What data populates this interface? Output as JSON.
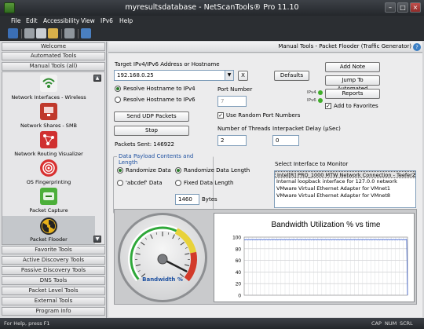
{
  "window": {
    "title": "myresultsdatabase - NetScanTools® Pro 11.10"
  },
  "menu": [
    "File",
    "Edit",
    "Accessibility",
    "View",
    "IPv6",
    "Help"
  ],
  "left_panel": {
    "top_bars": [
      "Welcome",
      "Automated Tools",
      "Manual Tools (all)"
    ],
    "tools": [
      {
        "label": "Network Interfaces - Wireless",
        "icon": "wifi-icon",
        "color": "#2e8b2e"
      },
      {
        "label": "Network Shares - SMB",
        "icon": "network-shares-icon",
        "color": "#c0392b"
      },
      {
        "label": "Network Routing Visualizer",
        "icon": "routing-visualizer-icon",
        "color": "#d03030"
      },
      {
        "label": "OS Fingerprinting",
        "icon": "fingerprint-icon",
        "color": "#d83030"
      },
      {
        "label": "Packet Capture",
        "icon": "packet-capture-icon",
        "color": "#4caf3a"
      },
      {
        "label": "Packet Flooder",
        "icon": "radiation-icon",
        "color": "#d4a017"
      }
    ],
    "bottom_bars": [
      "Favorite Tools",
      "Active Discovery Tools",
      "Passive Discovery Tools",
      "DNS Tools",
      "Packet Level Tools",
      "External Tools",
      "Program Info"
    ]
  },
  "main": {
    "header": "Manual Tools - Packet Flooder (Traffic Generator)",
    "target_label": "Target IPv4/IPv6 Address or Hostname",
    "target_value": "192.168.0.25",
    "clear_label": "X",
    "defaults_label": "Defaults",
    "add_note_label": "Add Note",
    "jump_label": "Jump To Automated",
    "reports_label": "Reports",
    "ipv4_label": "IPv4",
    "ipv6_label": "IPv6",
    "add_favorites_label": "Add to Favorites",
    "resolve_ipv4_label": "Resolve Hostname to IPv4",
    "resolve_ipv6_label": "Resolve Hostname to IPv6",
    "port_number_label": "Port Number",
    "port_number_value": "7",
    "send_udp_label": "Send UDP Packets",
    "use_random_ports_label": "Use Random Port Numbers",
    "stop_label": "Stop",
    "threads_label": "Number of Threads",
    "threads_value": "2",
    "interpacket_label": "Interpacket Delay (µSec)",
    "interpacket_value": "0",
    "packets_sent": "Packets Sent: 146922",
    "payload_group_title": "Data Payload Contents and Length",
    "randomize_data_label": "Randomize Data",
    "randomize_length_label": "Randomize Data Length",
    "abcdef_label": "'abcdef' Data",
    "fixed_length_label": "Fixed Data Length",
    "fixed_length_value": "1460",
    "bytes_label": "Bytes",
    "interface_label": "Select Interface to Monitor",
    "interfaces": [
      "Intel[R] PRO_1000 MTW Network Connection - Teefer2",
      "Internal loopback interface for 127.0.0 network",
      "VMware Virtual Ethernet Adapter for VMnet1",
      "VMware Virtual Ethernet Adapter for VMnet8"
    ],
    "gauge_label": "Bandwidth %"
  },
  "chart_data": {
    "type": "line",
    "title": "Bandwidth Utilization % vs time",
    "ylim": [
      0,
      100
    ],
    "yticks": [
      0,
      20,
      40,
      60,
      80,
      100
    ],
    "series": [
      {
        "values": [
          96,
          95,
          96,
          96,
          95,
          96,
          96,
          95,
          96,
          96,
          95,
          96,
          96,
          95,
          96,
          96,
          95,
          96,
          96,
          95,
          96,
          96,
          95,
          96,
          96,
          95,
          96,
          96,
          95,
          96,
          96,
          95,
          96,
          96,
          95,
          96,
          96,
          95,
          96,
          96,
          95,
          96,
          96,
          95,
          96,
          96,
          95,
          96,
          96,
          95,
          96,
          96,
          95,
          96,
          96,
          95,
          96,
          96,
          95,
          96,
          96,
          95,
          96,
          96,
          96,
          95,
          96,
          96,
          95,
          96,
          96,
          95,
          96,
          96,
          95,
          96,
          96,
          95,
          96,
          96,
          95,
          96,
          96,
          95,
          96,
          96,
          95,
          96,
          96,
          95,
          96,
          96,
          95,
          96,
          96,
          95,
          96,
          96,
          95,
          96,
          96,
          95,
          96,
          96,
          95,
          96,
          96,
          95,
          96,
          96,
          95,
          96,
          96,
          95,
          96,
          96,
          95,
          96,
          96,
          95,
          96,
          96,
          95,
          96,
          96,
          95,
          96,
          96,
          95,
          96,
          96,
          95,
          96,
          96,
          95,
          96,
          96,
          95,
          96,
          96,
          95,
          96,
          96,
          95,
          96,
          96,
          95,
          96,
          96,
          95,
          96,
          96,
          95,
          96,
          96,
          95,
          96,
          96,
          95,
          96,
          96,
          95,
          96,
          96,
          95,
          96,
          96,
          95,
          96,
          96,
          95,
          96,
          96,
          95,
          96,
          96,
          95,
          96,
          96,
          95,
          96,
          96,
          95,
          96,
          96,
          95,
          96,
          96,
          95,
          96,
          96,
          95,
          96,
          96,
          0
        ],
        "color": "#3a5fcd"
      }
    ],
    "grid": true,
    "gauge_value_percent": 95
  },
  "status": {
    "help": "For Help, press F1",
    "cap": "CAP",
    "num": "NUM",
    "scrl": "SCRL"
  }
}
